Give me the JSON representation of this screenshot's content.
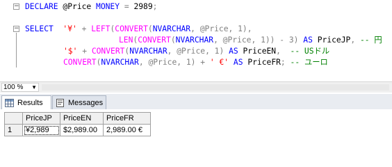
{
  "editor": {
    "line1": {
      "kw": "DECLARE",
      "var": " @Price ",
      "type": "MONEY",
      "op": " = ",
      "num": "2989",
      "end": ";"
    },
    "line3": {
      "select": "SELECT",
      "sp": "  ",
      "str1": "'¥'",
      "plus": " + ",
      "left": "LEFT",
      "p1": "(",
      "convert": "CONVERT",
      "p2": "(",
      "nvarchar": "NVARCHAR",
      "comma": ", @Price, 1),"
    },
    "line4": {
      "len": "LEN",
      "p1": "(",
      "convert": "CONVERT",
      "p2": "(",
      "nvarchar": "NVARCHAR",
      "rest1": ", @Price, 1)) - 3)",
      "as": " AS ",
      "alias": "PriceJP",
      "comma": ",",
      "comment": " -- 円"
    },
    "line5": {
      "str": "'$'",
      "plus": " + ",
      "convert": "CONVERT",
      "p": "(",
      "nvarchar": "NVARCHAR",
      "rest": ", @Price, 1)",
      "as": " AS ",
      "alias": "PriceEN",
      "comma": ",",
      "comment": "  -- USドル"
    },
    "line6": {
      "convert": "CONVERT",
      "p": "(",
      "nvarchar": "NVARCHAR",
      "rest": ", @Price, 1)",
      "plus": " + ",
      "str": "' €'",
      "as": " AS ",
      "alias": "PriceFR",
      "end": ";",
      "comment": " -- ユーロ"
    }
  },
  "zoom": {
    "value": "100 %"
  },
  "tabs": {
    "results": "Results",
    "messages": "Messages"
  },
  "results": {
    "columns": [
      "PriceJP",
      "PriceEN",
      "PriceFR"
    ],
    "rows": [
      {
        "num": "1",
        "cells": [
          "¥2,989",
          "$2,989.00",
          "2,989.00 €"
        ]
      }
    ]
  }
}
